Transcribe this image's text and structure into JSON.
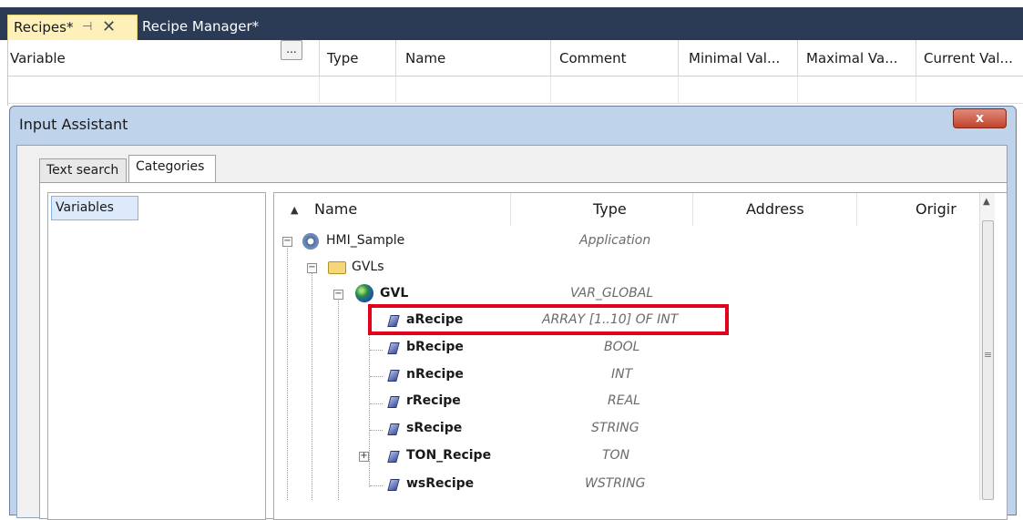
{
  "tabs": {
    "active_label": "Recipes*",
    "pin_glyph": "⊣",
    "close_glyph": "✕",
    "second_label": "Recipe Manager*"
  },
  "grid": {
    "columns": [
      "Variable",
      "Type",
      "Name",
      "Comment",
      "Minimal Val...",
      "Maximal Va...",
      "Current Val..."
    ],
    "browse_button": "..."
  },
  "dialog": {
    "title": "Input Assistant",
    "close_label": "x",
    "tabs": [
      "Text search",
      "Categories"
    ],
    "selected_tab": "Categories",
    "categories": [
      "Variables"
    ],
    "tree_headers": {
      "name": "Name",
      "type": "Type",
      "address": "Address",
      "origin": "Origir"
    },
    "tree": [
      {
        "name": "HMI_Sample",
        "type": "Application",
        "icon": "application-gear-icon",
        "bold": false
      },
      {
        "name": "GVLs",
        "type": "",
        "icon": "folder-icon",
        "bold": false
      },
      {
        "name": "GVL",
        "type": "VAR_GLOBAL",
        "icon": "globe-icon",
        "bold": true
      },
      {
        "name": "aRecipe",
        "type": "ARRAY [1..10] OF INT",
        "icon": "variable-icon",
        "bold": true
      },
      {
        "name": "bRecipe",
        "type": "BOOL",
        "icon": "variable-icon",
        "bold": true
      },
      {
        "name": "nRecipe",
        "type": "INT",
        "icon": "variable-icon",
        "bold": true
      },
      {
        "name": "rRecipe",
        "type": "REAL",
        "icon": "variable-icon",
        "bold": true
      },
      {
        "name": "sRecipe",
        "type": "STRING",
        "icon": "variable-icon",
        "bold": true
      },
      {
        "name": "TON_Recipe",
        "type": "TON",
        "icon": "variable-icon",
        "bold": true
      },
      {
        "name": "wsRecipe",
        "type": "WSTRING",
        "icon": "variable-icon",
        "bold": true
      }
    ]
  },
  "colors": {
    "highlight": "#e3001b",
    "active_tab": "#fdf0b8",
    "tab_band": "#2b3a55"
  }
}
